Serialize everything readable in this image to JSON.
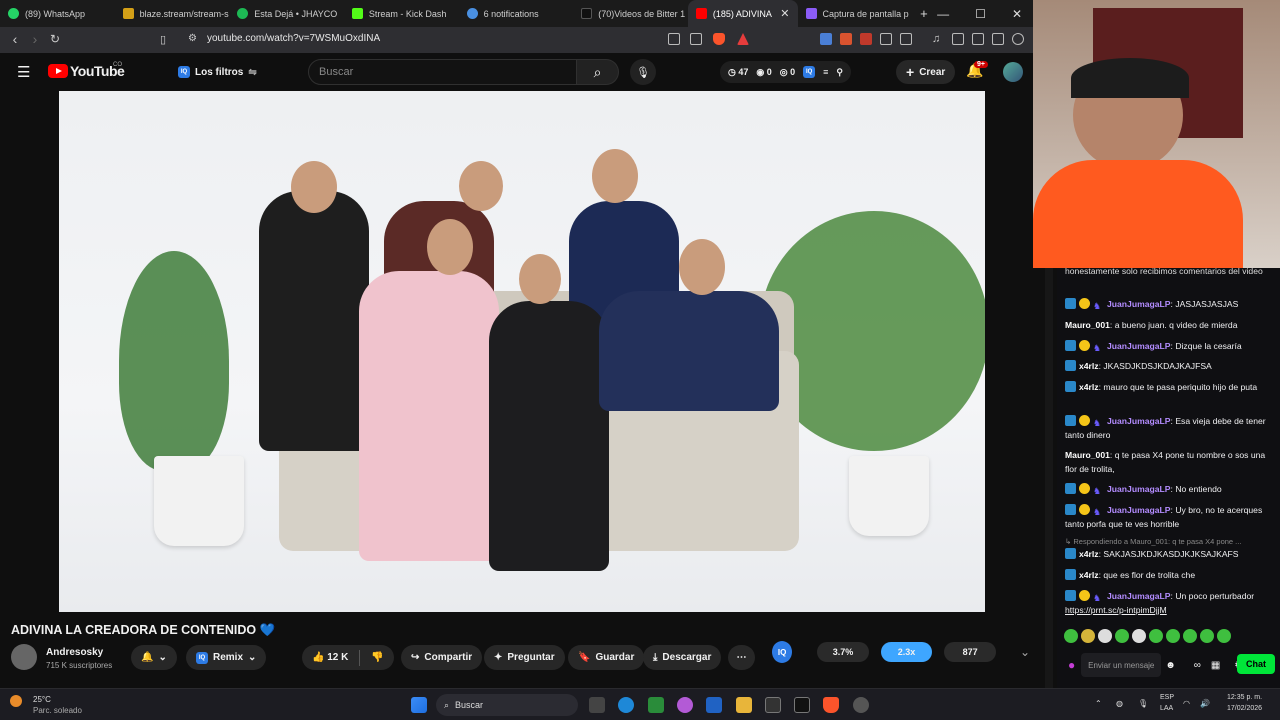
{
  "tabs": [
    {
      "label": "(89) WhatsApp",
      "color": "#25d366"
    },
    {
      "label": "blaze.stream/stream-s",
      "color": "#d4a017"
    },
    {
      "label": "Esta Dejá • JHAYCO",
      "color": "#1db954"
    },
    {
      "label": "Stream - Kick Dash",
      "color": "#53fc18"
    },
    {
      "label": "6 notifications",
      "color": "#4a90e2"
    },
    {
      "label": "(70)Videos de Bitter 1",
      "color": "#000000"
    },
    {
      "label": "(185) ADIVINA",
      "color": "#ff0000"
    },
    {
      "label": "Captura de pantalla p",
      "color": "#8b5cf6"
    }
  ],
  "address": {
    "url": "youtube.com/watch?v=7WSMuOxdINA"
  },
  "header": {
    "logo": "YouTube",
    "logo_cc": "CO",
    "filters_label": "Los filtros",
    "search_placeholder": "Buscar",
    "stats": {
      "views_like": "47",
      "eye": "0",
      "dislike": "0"
    },
    "create_label": "Crear",
    "notif_badge": "9+"
  },
  "video": {
    "title": "ADIVINA LA CREADORA DE CONTENIDO 💙",
    "channel": "Andresosky",
    "subscribers": "715 K suscriptores",
    "remix_label": "Remix",
    "likes": "12 K",
    "share_label": "Compartir",
    "ask_label": "Preguntar",
    "save_label": "Guardar",
    "download_label": "Descargar"
  },
  "iq_stats": {
    "pct": "3.7%",
    "mult": "2.3x",
    "count": "877"
  },
  "chat": {
    "messages": [
      {
        "user": "",
        "text": "honestamente solo recibimos comentarios del video"
      },
      {
        "user": "JuanJumagaLP",
        "text": "JASJASJASJAS",
        "badges": true
      },
      {
        "user": "Mauro_001",
        "text": "a bueno juan. q video de mierda",
        "badges": false
      },
      {
        "user": "JuanJumagaLP",
        "text": "Dizque la cesaría",
        "badges": true
      },
      {
        "user": "x4rlz",
        "text": "JKASDJKDSJKDAJKAJFSA",
        "badges": "one"
      },
      {
        "user": "x4rlz",
        "text": "mauro que te pasa periquito hijo de puta",
        "badges": "one"
      },
      {
        "user": "JuanJumagaLP",
        "text": "Esa vieja debe de tener tanto dinero",
        "badges": true
      },
      {
        "user": "Mauro_001",
        "text": "q te pasa X4 pone tu nombre o sos una flor de trolita,",
        "badges": false
      },
      {
        "user": "JuanJumagaLP",
        "text": "No entiendo",
        "badges": true
      },
      {
        "user": "JuanJumagaLP",
        "text": "Uy bro, no te acerques tanto porfa que te ves horrible",
        "badges": true
      },
      {
        "reply": "Respondiendo a Mauro_001: q te pasa X4 pone ...",
        "user": "x4rlz",
        "text": "SAKJASJKDJKASDJKJKSAJKAFS",
        "badges": "one"
      },
      {
        "user": "x4rlz",
        "text": "que es flor de trolita che",
        "badges": "one"
      },
      {
        "user": "JuanJumagaLP",
        "text": "Un poco perturbador",
        "badges": true,
        "link": "https://prnt.sc/p-intpimDjjM"
      }
    ],
    "input_placeholder": "Enviar un mensaje",
    "chat_button": "Chat"
  },
  "taskbar": {
    "weather_temp": "25°C",
    "weather_desc": "Parc. soleado",
    "search_label": "Buscar",
    "lang": "ESP",
    "lang2": "LAA",
    "time": "12:35 p. m.",
    "date": "17/02/2026"
  }
}
